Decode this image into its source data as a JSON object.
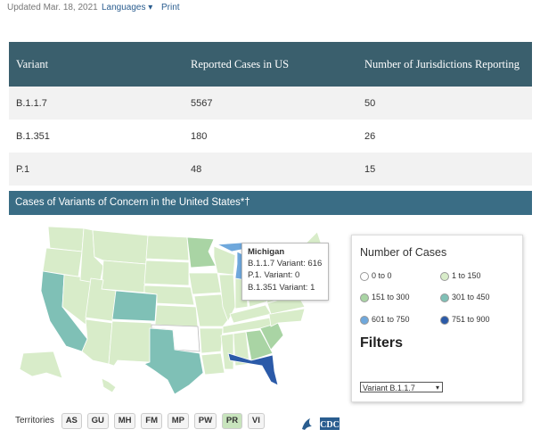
{
  "header": {
    "updated": "Updated Mar. 18, 2021",
    "languages": "Languages ▾",
    "print": "Print"
  },
  "table": {
    "headers": [
      "Variant",
      "Reported Cases in US",
      "Number of Jurisdictions Reporting"
    ],
    "rows": [
      [
        "B.1.1.7",
        "5567",
        "50"
      ],
      [
        "B.1.351",
        "180",
        "26"
      ],
      [
        "P.1",
        "48",
        "15"
      ]
    ]
  },
  "section": {
    "title": "Cases of Variants of Concern in the United States*†"
  },
  "tooltip": {
    "title": "Michigan",
    "lines": [
      "B.1.1.7 Variant: 616",
      "P.1. Variant: 0",
      "B.1.351 Variant: 1"
    ]
  },
  "legend": {
    "title": "Number of Cases",
    "items": [
      {
        "label": "0 to 0",
        "color": "#ffffff"
      },
      {
        "label": "1 to 150",
        "color": "#d8ecc9"
      },
      {
        "label": "151 to 300",
        "color": "#a9d4a4"
      },
      {
        "label": "301 to 450",
        "color": "#7fc0b6"
      },
      {
        "label": "601 to 750",
        "color": "#6fa8dc"
      },
      {
        "label": "751 to 900",
        "color": "#2b5aa8"
      }
    ],
    "filters_label": "Filters",
    "variant_select": "Variant B.1.1.7"
  },
  "territories": {
    "label": "Territories",
    "items": [
      "AS",
      "GU",
      "MH",
      "FM",
      "MP",
      "PW",
      "PR",
      "VI"
    ]
  },
  "cdc_logo": "CDC",
  "colors": {
    "table_header": "#3a5f6d",
    "section_bar": "#3a6d85",
    "michigan": "#6fa8dc",
    "florida": "#2b5aa8"
  }
}
